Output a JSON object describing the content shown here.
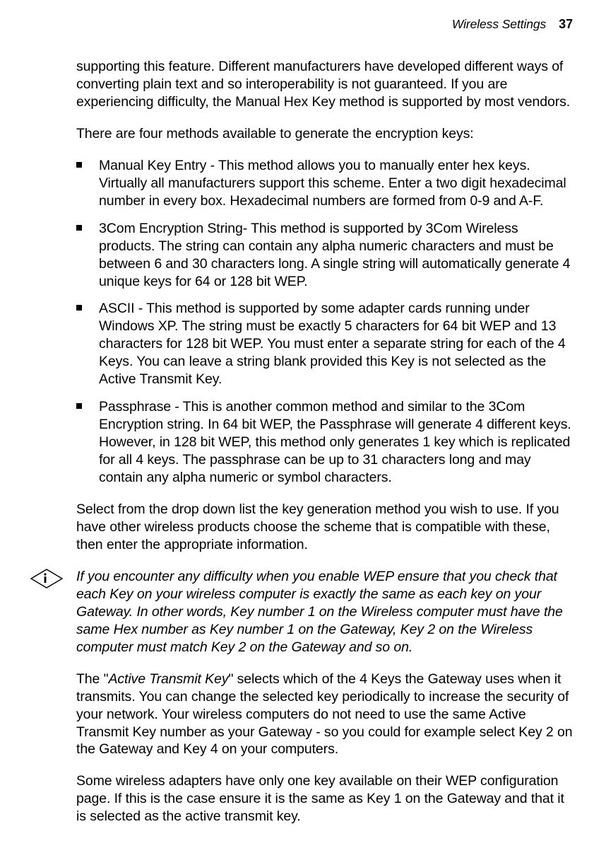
{
  "header": {
    "section": "Wireless Settings",
    "page": "37"
  },
  "p1": "supporting this feature. Different manufacturers have developed different ways of converting plain text and so interoperability is not guaranteed. If you are experiencing difficulty, the Manual Hex Key method is supported by most vendors.",
  "p2": "There are four methods available to generate the encryption keys:",
  "bullets": [
    "Manual Key Entry - This method allows you to manually enter hex keys. Virtually all manufacturers support this scheme. Enter a two digit hexadecimal number in every box. Hexadecimal numbers are formed from 0-9 and A-F.",
    "3Com Encryption String- This method is supported by 3Com Wireless products. The string can contain any alpha numeric characters and must be between 6 and 30 characters long. A single string will automatically generate 4 unique keys for 64 or 128 bit WEP.",
    "ASCII - This method is supported by some adapter cards running under Windows XP. The string must be exactly 5 characters for 64 bit WEP and 13 characters for 128 bit WEP. You must enter a separate string for each of the 4 Keys. You can leave a string blank provided this Key is not selected as the Active Transmit Key.",
    "Passphrase - This is another common method and similar to the 3Com Encryption string. In 64 bit WEP, the Passphrase will generate 4 different keys. However, in 128 bit WEP, this method only generates 1 key which is replicated for all 4 keys. The passphrase can be up to 31 characters long and may contain any alpha numeric or symbol characters."
  ],
  "p3": "Select from the drop down list the key generation method you wish to use. If you have other wireless products choose the scheme that is compatible with these, then enter the appropriate information.",
  "note": "If you encounter any difficulty when you enable WEP ensure that you check that each Key on your wireless computer is exactly the same as each key on your Gateway. In other words, Key number 1 on the Wireless computer must have the same Hex number as Key number 1 on the Gateway, Key 2 on the Wireless computer must match Key 2 on the Gateway and so on.",
  "p4_pre": "The \"",
  "p4_em": "Active Transmit Key",
  "p4_post": "\" selects which of the 4 Keys the Gateway uses when it transmits. You can change the selected key periodically to increase the security of your network. Your wireless computers do not need to use the same Active Transmit Key number as your Gateway - so you could for example select Key 2 on the Gateway and Key 4 on your computers.",
  "p5": "Some wireless adapters have only one key available on their WEP configuration page. If this is the case ensure it is the same as Key 1 on the Gateway and that it is selected as the active transmit key."
}
